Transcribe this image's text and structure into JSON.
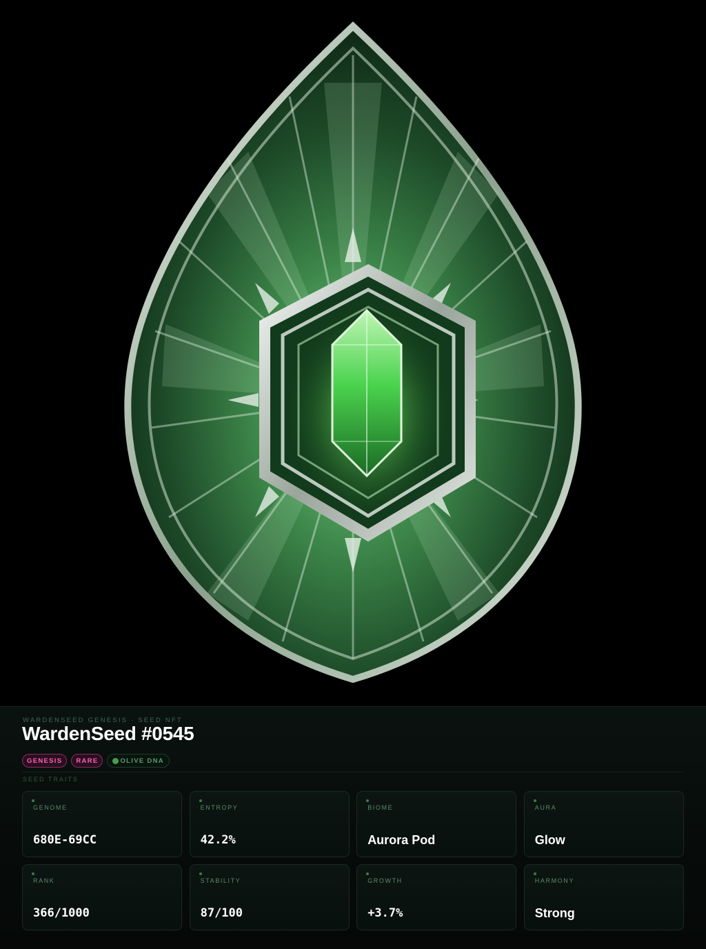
{
  "header": {
    "eyebrow": "WARDENSEED GENESIS · SEED NFT",
    "title": "WardenSeed #0545"
  },
  "badges": [
    {
      "label": "GENESIS"
    },
    {
      "label": "RARE"
    },
    {
      "label": "OLIVE DNA"
    }
  ],
  "traits_section": {
    "label": "SEED TRAITS"
  },
  "traits": [
    {
      "label": "GENOME",
      "value": "680E-69CC"
    },
    {
      "label": "ENTROPY",
      "value": "42.2%"
    },
    {
      "label": "BIOME",
      "value": "Aurora Pod"
    },
    {
      "label": "AURA",
      "value": "Glow"
    },
    {
      "label": "RANK",
      "value": "366/1000"
    },
    {
      "label": "STABILITY",
      "value": "87/100"
    },
    {
      "label": "GROWTH",
      "value": "+3.7%"
    },
    {
      "label": "HARMONY",
      "value": "Strong"
    }
  ],
  "colors": {
    "accent_green": "#4f9a50",
    "badge_pink": "#ff5fb6",
    "panel_bg": "#0a1210"
  },
  "icons": {
    "hero": "emerald-seed-gem-image",
    "badge_dot": "green-dot-icon",
    "trait_dot": "green-dot-icon"
  }
}
